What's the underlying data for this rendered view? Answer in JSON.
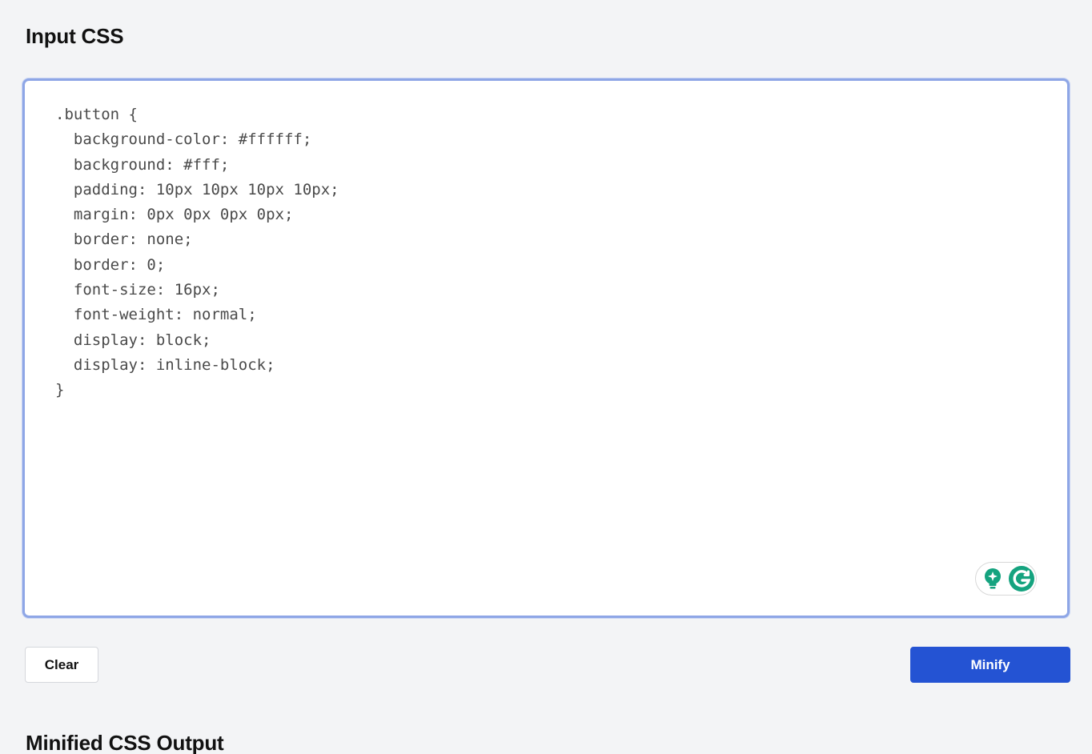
{
  "input_section": {
    "title": "Input CSS",
    "code": ".button {\n  background-color: #ffffff;\n  background: #fff;\n  padding: 10px 10px 10px 10px;\n  margin: 0px 0px 0px 0px;\n  border: none;\n  border: 0;\n  font-size: 16px;\n  font-weight: normal;\n  display: block;\n  display: inline-block;\n}"
  },
  "actions": {
    "clear_label": "Clear",
    "minify_label": "Minify"
  },
  "output_section": {
    "title": "Minified CSS Output"
  },
  "icons": {
    "assistant_bulb": "lightbulb-icon",
    "grammarly": "grammarly-icon"
  },
  "colors": {
    "accent": "#2453d3",
    "editor_focus_border": "#8ea6e6",
    "grammarly_green": "#15a37f",
    "background": "#f3f4f6"
  }
}
